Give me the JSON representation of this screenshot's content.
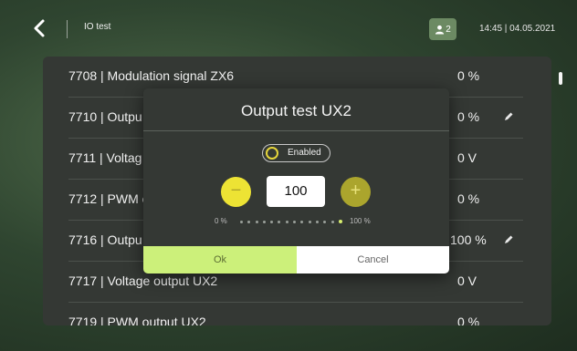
{
  "header": {
    "back_icon": "chevron-left-icon",
    "title": "IO test",
    "user_icon": "users-icon",
    "user_count": "2",
    "datetime": "14:45 | 04.05.2021",
    "badge_color": "#6c8a63"
  },
  "list": {
    "rows": [
      {
        "name": "7708 | Modulation signal ZX6",
        "value": "0 %",
        "editable": false
      },
      {
        "name": "7710 | Outpu",
        "value": "0 %",
        "editable": true
      },
      {
        "name": "7711 | Voltag",
        "value": "0 V",
        "editable": false
      },
      {
        "name": "7712 | PWM c",
        "value": "0 %",
        "editable": false
      },
      {
        "name": "7716 | Outpu",
        "value": "100 %",
        "editable": true
      },
      {
        "name": "7717 | Voltage output UX2",
        "value": "0 V",
        "editable": false
      },
      {
        "name": "7719 | PWM output UX2",
        "value": "0 %",
        "editable": false
      }
    ]
  },
  "dialog": {
    "title": "Output test UX2",
    "toggle_label": "Enabled",
    "toggle_on": true,
    "minus_label": "−",
    "plus_label": "+",
    "value": "100",
    "range_min": "0 %",
    "range_max": "100 %",
    "slider_percent": 100,
    "ok_label": "Ok",
    "cancel_label": "Cancel",
    "accent_color": "#ede334",
    "ok_color": "#ccf07a"
  }
}
